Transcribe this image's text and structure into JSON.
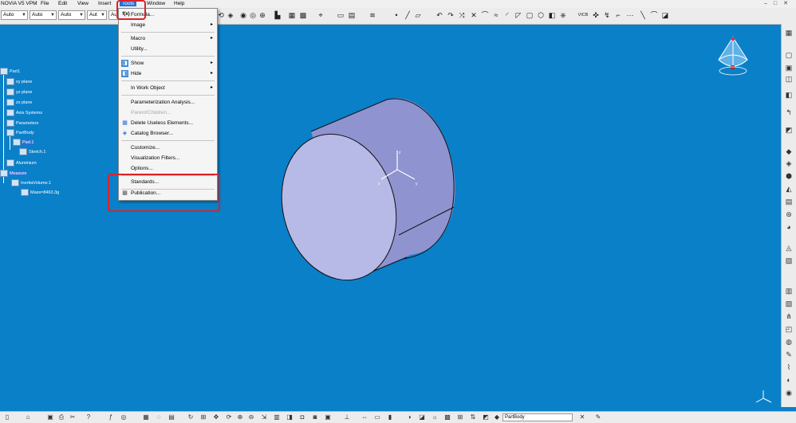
{
  "window": {
    "title": "NOVIA V5 VPM"
  },
  "menubar": {
    "items": [
      "File",
      "Edit",
      "View",
      "Insert",
      "Tools",
      "Window",
      "Help"
    ],
    "active": "Tools"
  },
  "toolbar": {
    "combos": [
      "Auto",
      "Auto",
      "Auto",
      "Aut",
      "Au"
    ],
    "dropdown_arrow": "▼",
    "label_vicb": "VICB"
  },
  "tools_menu": {
    "formula": {
      "icon": "f(x)",
      "label": "Formula..."
    },
    "image": "Image",
    "macro": "Macro",
    "utility": "Utility...",
    "show": "Show",
    "hide": "Hide",
    "in_work_object": "In Work Object",
    "parameterization": "Parameterization Analysis...",
    "disabled_item": "Parent/Children...",
    "delete_useless": "Delete Useless Elements...",
    "catalog_browser": "Catalog Browser...",
    "customize": "Customize...",
    "visualization_filters": "Visualization Filters...",
    "options": "Options...",
    "standards": "Standards...",
    "publication": "Publication...",
    "submenu_arrow": "▸"
  },
  "tree": {
    "part": "Part1",
    "xy": "xy plane",
    "yz": "yz plane",
    "zx": "zx plane",
    "axis_systems": "Axis Systems",
    "parameters": "Parameters",
    "partbody": "PartBody",
    "pad": "Pad.1",
    "sketch": "Sketch.1",
    "material": "Aluminium",
    "measure": "Measure",
    "inertia": "InertiaVolume.1",
    "mass": "Mass=8463.3g"
  },
  "statusbar": {
    "partbody_combo": "PartBody"
  },
  "colors": {
    "viewport": "#0a80c9",
    "highlight": "#d8232a",
    "cylinder_face": "#b7b9e6",
    "cylinder_side": "#8f93cf"
  }
}
